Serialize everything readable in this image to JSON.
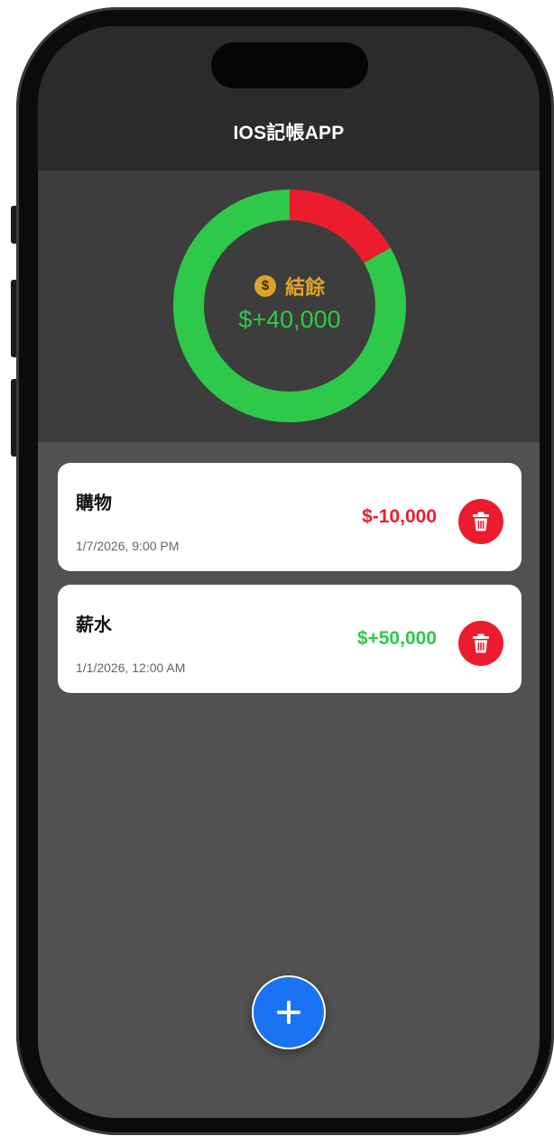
{
  "app": {
    "title": "IOS記帳APP"
  },
  "summary": {
    "balance_label": "結餘",
    "balance_amount": "$+40,000",
    "coin_symbol": "$",
    "coin_icon": "dollar-coin-icon",
    "total_income": 50000,
    "total_expense": 10000
  },
  "transactions": [
    {
      "title": "購物",
      "date": "1/7/2026, 9:00 PM",
      "amount": "$-10,000",
      "type": "expense",
      "delete_icon": "trash-icon"
    },
    {
      "title": "薪水",
      "date": "1/1/2026, 12:00 AM",
      "amount": "$+50,000",
      "type": "income",
      "delete_icon": "trash-icon"
    }
  ],
  "fab": {
    "icon": "plus-icon"
  },
  "colors": {
    "income": "#2ec94a",
    "expense": "#ec1b2e",
    "coin": "#e0a32b",
    "accent": "#1a73f2"
  }
}
